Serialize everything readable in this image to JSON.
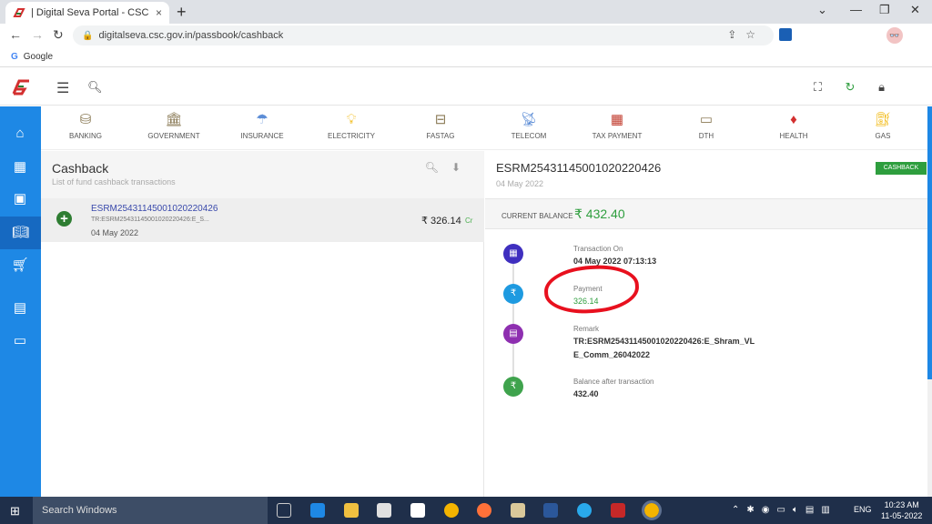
{
  "browser": {
    "tab_title": "| Digital Seva Portal - CSC e-Gov",
    "tab_close": "×",
    "new_tab": "+",
    "url": "digitalseva.csc.gov.in/passbook/cashback",
    "bookmark": "Google",
    "window_controls": [
      "⌄",
      "—",
      "❐",
      "✕"
    ]
  },
  "categories": [
    "BANKING",
    "GOVERNMENT",
    "INSURANCE",
    "ELECTRICITY",
    "FASTAG",
    "TELECOM",
    "TAX PAYMENT",
    "DTH",
    "HEALTH",
    "GAS"
  ],
  "left_panel": {
    "title": "Cashback",
    "subtitle": "List of fund cashback transactions",
    "transaction": {
      "id": "ESRM25431145001020220426",
      "remark": "TR:ESRM25431145001020220426:E_S...",
      "date": "04 May 2022",
      "amount": "₹ 326.14",
      "type": "Cr"
    }
  },
  "right_panel": {
    "title": "ESRM25431145001020220426",
    "date": "04 May 2022",
    "badge": "CASHBACK",
    "balance_label": "CURRENT BALANCE",
    "balance_value": "₹ 432.40",
    "details": [
      {
        "label": "Transaction On",
        "value": "04 May 2022 07:13:13",
        "color": "#3f2fbf"
      },
      {
        "label": "Payment",
        "value": "326.14",
        "color": "#1e9ae0"
      },
      {
        "label": "Remark",
        "value": "TR:ESRM25431145001020220426:E_Shram_VL",
        "value2": "E_Comm_26042022",
        "color": "#8e2fb0"
      },
      {
        "label": "Balance after transaction",
        "value": "432.40",
        "color": "#3fa34d"
      }
    ]
  },
  "taskbar": {
    "search_placeholder": "Search Windows",
    "language": "ENG",
    "time": "10:23 AM",
    "date": "11-05-2022"
  },
  "colors": {
    "sidebar": "#1e88e5",
    "accent_green": "#2e9e3e",
    "highlight_red": "#e8101e"
  }
}
